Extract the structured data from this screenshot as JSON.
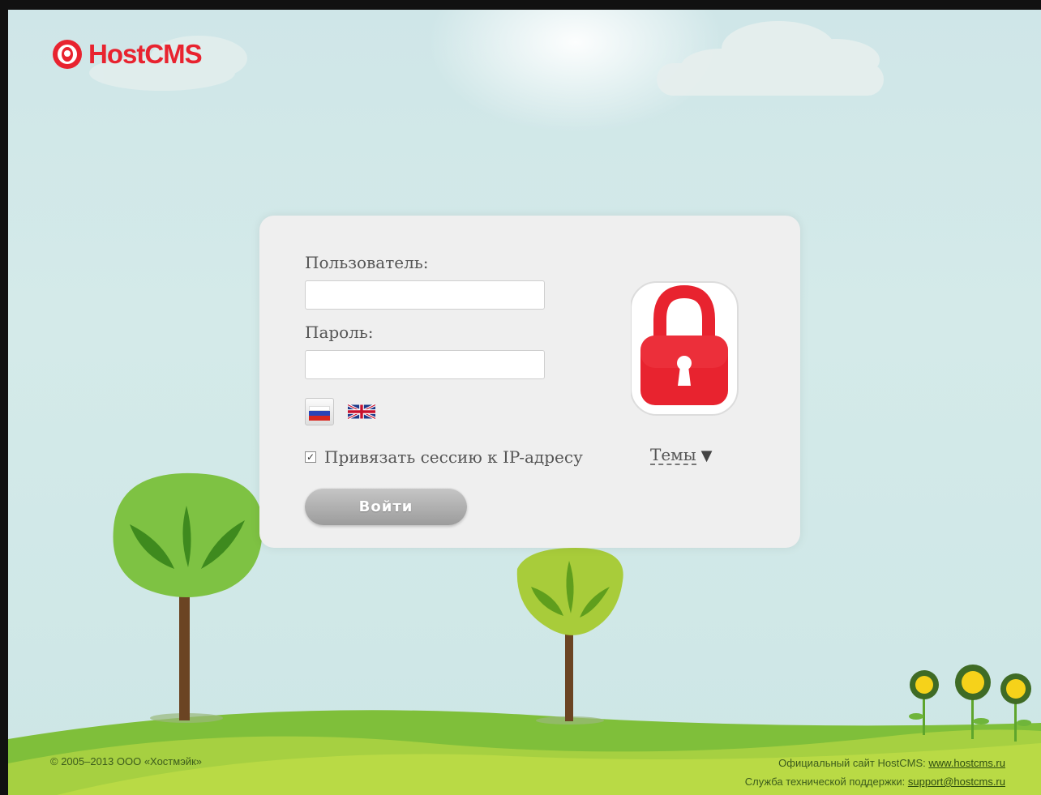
{
  "brand": {
    "name": "HostCMS"
  },
  "login": {
    "username_label": "Пользователь:",
    "username_value": "",
    "password_label": "Пароль:",
    "password_value": "",
    "languages": [
      "Русский",
      "English"
    ],
    "bind_ip_label": "Привязать сессию к IP-адресу",
    "bind_ip_checked": true,
    "themes_label": "Темы",
    "submit_label": "Войти"
  },
  "footer": {
    "copyright": "© 2005–2013 ООО «Хостмэйк»",
    "official_site_label": "Официальный сайт HostCMS:",
    "official_site_link": "www.hostcms.ru",
    "support_label": "Служба технической поддержки:",
    "support_link": "support@hostcms.ru"
  },
  "colors": {
    "brand_red": "#e8232f",
    "sky": "#d2e8e8",
    "grass": "#8cc63f",
    "button_gray": "#a8a8a8"
  }
}
